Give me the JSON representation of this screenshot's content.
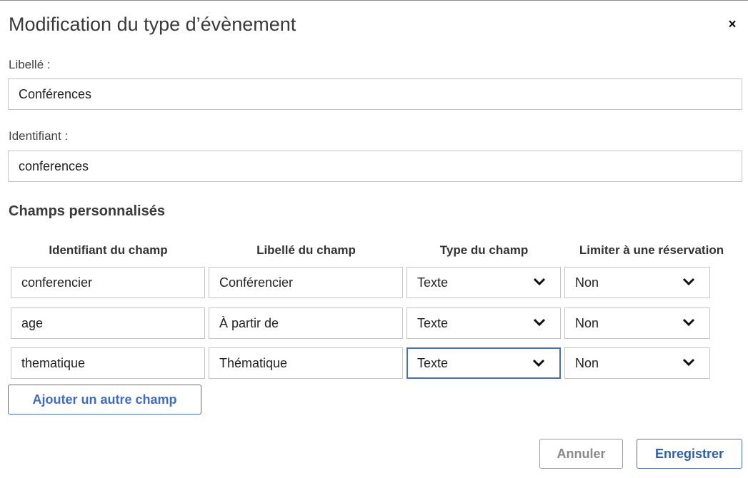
{
  "dialog": {
    "title": "Modification du type d’évènement",
    "close_label": "×"
  },
  "form": {
    "label_field": {
      "label": "Libellé :",
      "value": "Conférences"
    },
    "identifier_field": {
      "label": "Identifiant :",
      "value": "conferences"
    }
  },
  "custom_fields": {
    "section_title": "Champs personnalisés",
    "headers": [
      "Identifiant du champ",
      "Libellé du champ",
      "Type du champ",
      "Limiter à une réservation"
    ],
    "rows": [
      {
        "identifier": "conferencier",
        "label": "Conférencier",
        "type": "Texte",
        "limit": "Non"
      },
      {
        "identifier": "age",
        "label": "À partir de",
        "type": "Texte",
        "limit": "Non"
      },
      {
        "identifier": "thematique",
        "label": "Thématique",
        "type": "Texte",
        "limit": "Non"
      }
    ],
    "add_button_label": "Ajouter un autre champ"
  },
  "actions": {
    "cancel_label": "Annuler",
    "save_label": "Enregistrer"
  },
  "colors": {
    "accent": "#3f6cc0",
    "focus_border": "#4a6fb5",
    "input_border": "#c4c4c4"
  },
  "icons": {
    "close": "close-icon",
    "select_arrow": "chevron-down-icon"
  }
}
